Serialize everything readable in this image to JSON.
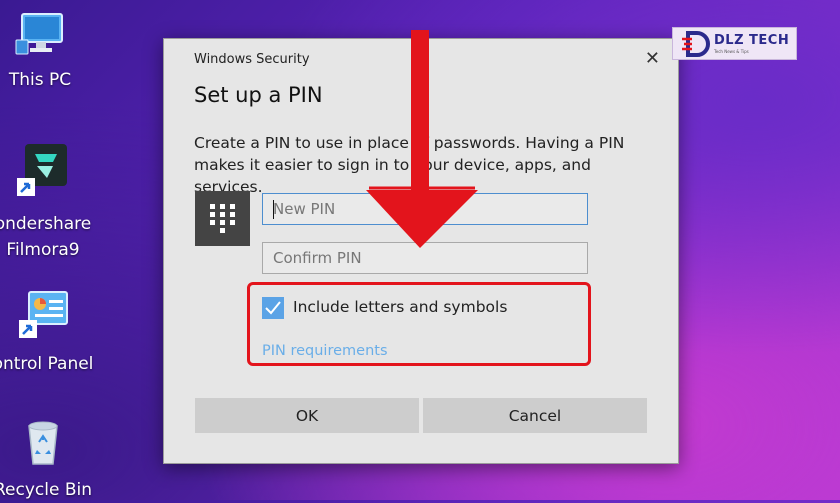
{
  "desktop": {
    "icons": [
      {
        "name": "this-pc",
        "label": "This PC"
      },
      {
        "name": "filmora",
        "label": "ondershare Filmora9"
      },
      {
        "name": "control-panel",
        "label": "ontrol Panel"
      },
      {
        "name": "recycle-bin",
        "label": "Recycle Bin"
      }
    ]
  },
  "dialog": {
    "window_title": "Windows Security",
    "close_glyph": "✕",
    "heading": "Set up a PIN",
    "description": "Create a PIN to use in place of passwords. Having a PIN makes it easier to sign in to your device, apps, and services.",
    "new_pin_placeholder": "New PIN",
    "confirm_pin_placeholder": "Confirm PIN",
    "include_letters_label": "Include letters and symbols",
    "include_letters_checked": true,
    "pin_requirements_link": "PIN requirements",
    "ok_label": "OK",
    "cancel_label": "Cancel"
  },
  "watermark": {
    "brand": "DLZ TECH",
    "tagline": "Tech News & Tips"
  },
  "colors": {
    "accent": "#5ba3e6",
    "link": "#6aaee8",
    "highlight": "#e3141c",
    "arrow": "#e3141c"
  },
  "icons": [
    "computer-icon",
    "filmora-icon",
    "control-panel-icon",
    "recycle-bin-icon",
    "keypad-icon",
    "checkmark-icon",
    "close-icon",
    "arrow-down-icon"
  ]
}
